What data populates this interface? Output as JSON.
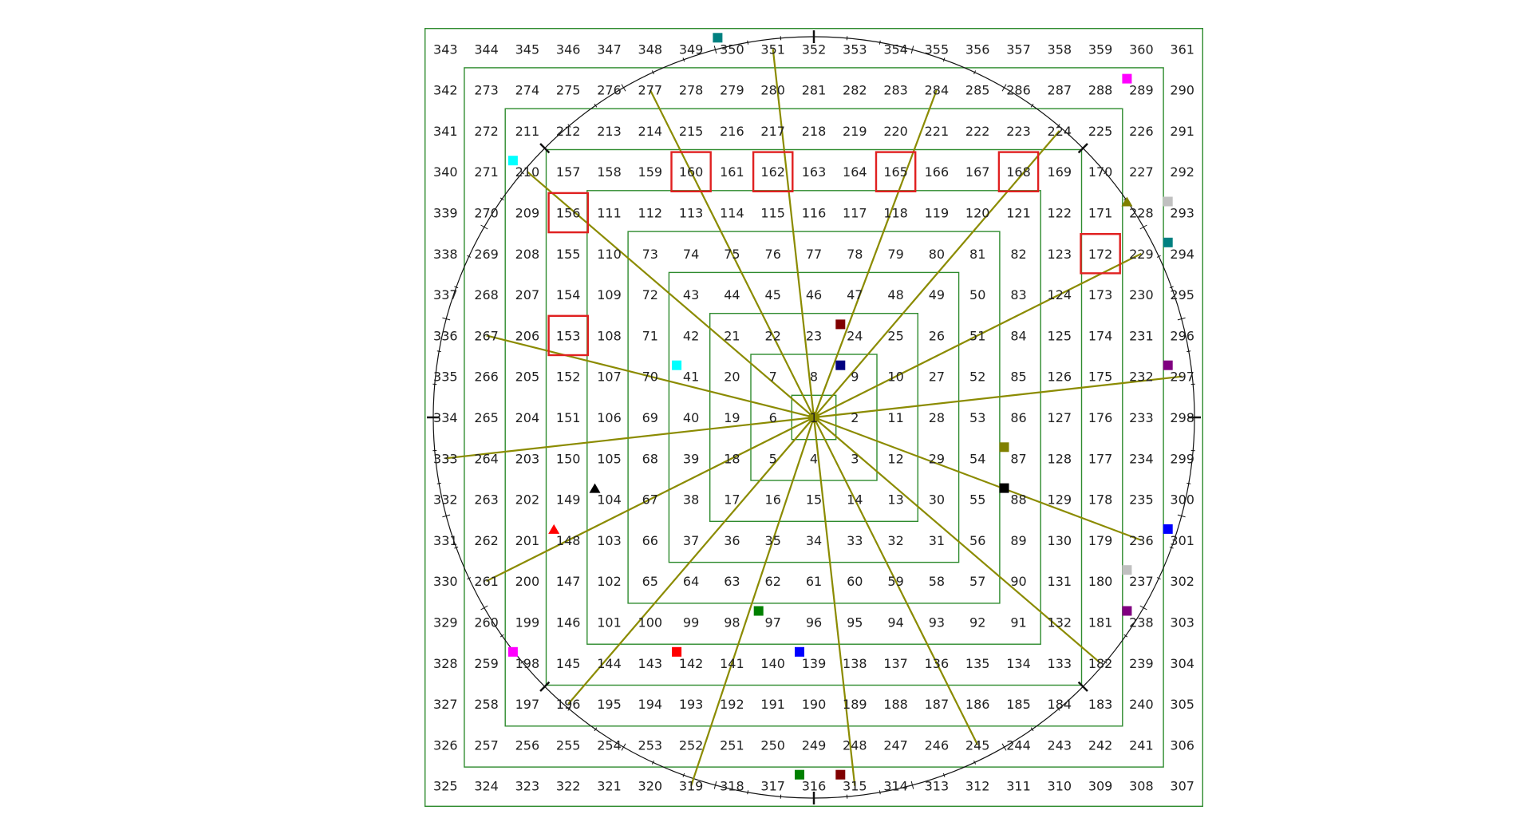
{
  "grid": {
    "size": 19,
    "start": 1,
    "end": 361,
    "line_color": "#2e8b2e",
    "number_color": "#222222"
  },
  "highlighted_numbers": [
    153,
    156,
    160,
    162,
    165,
    168,
    172
  ],
  "highlight_color": "#e02020",
  "spoke_color": "#8b8b00",
  "spoke_endpoints": [
    319,
    315,
    245,
    182,
    236,
    297,
    229,
    224,
    284,
    351,
    277,
    210,
    267,
    333,
    261,
    196
  ],
  "circle_color": "#111111",
  "markers": [
    {
      "near": 316,
      "shape": "square",
      "color": "#008000"
    },
    {
      "near": 315,
      "shape": "square",
      "color": "#800000"
    },
    {
      "near": 142,
      "shape": "square",
      "color": "#ff0000"
    },
    {
      "near": 139,
      "shape": "square",
      "color": "#0000ff"
    },
    {
      "near": 97,
      "shape": "square",
      "color": "#008000"
    },
    {
      "near": 198,
      "shape": "square",
      "color": "#ff00ff"
    },
    {
      "near": 238,
      "shape": "square",
      "color": "#800080"
    },
    {
      "near": 237,
      "shape": "square",
      "color": "#c0c0c0"
    },
    {
      "near": 301,
      "shape": "square",
      "color": "#0000ff"
    },
    {
      "near": 88,
      "shape": "square",
      "color": "#000000"
    },
    {
      "near": 87,
      "shape": "square",
      "color": "#808000"
    },
    {
      "near": 148,
      "shape": "triangle",
      "color": "#ff0000"
    },
    {
      "near": 104,
      "shape": "triangle",
      "color": "#000000"
    },
    {
      "near": 41,
      "shape": "square",
      "color": "#00ffff"
    },
    {
      "near": 9,
      "shape": "square",
      "color": "#000080"
    },
    {
      "near": 24,
      "shape": "square",
      "color": "#800000"
    },
    {
      "near": 297,
      "shape": "square",
      "color": "#800080"
    },
    {
      "near": 294,
      "shape": "square",
      "color": "#008080"
    },
    {
      "near": 293,
      "shape": "square",
      "color": "#c0c0c0"
    },
    {
      "near": 228,
      "shape": "triangle",
      "color": "#808000"
    },
    {
      "near": 210,
      "shape": "square",
      "color": "#00ffff"
    },
    {
      "near": 289,
      "shape": "square",
      "color": "#ff00ff"
    },
    {
      "near": 350,
      "shape": "square",
      "color": "#008080"
    }
  ]
}
